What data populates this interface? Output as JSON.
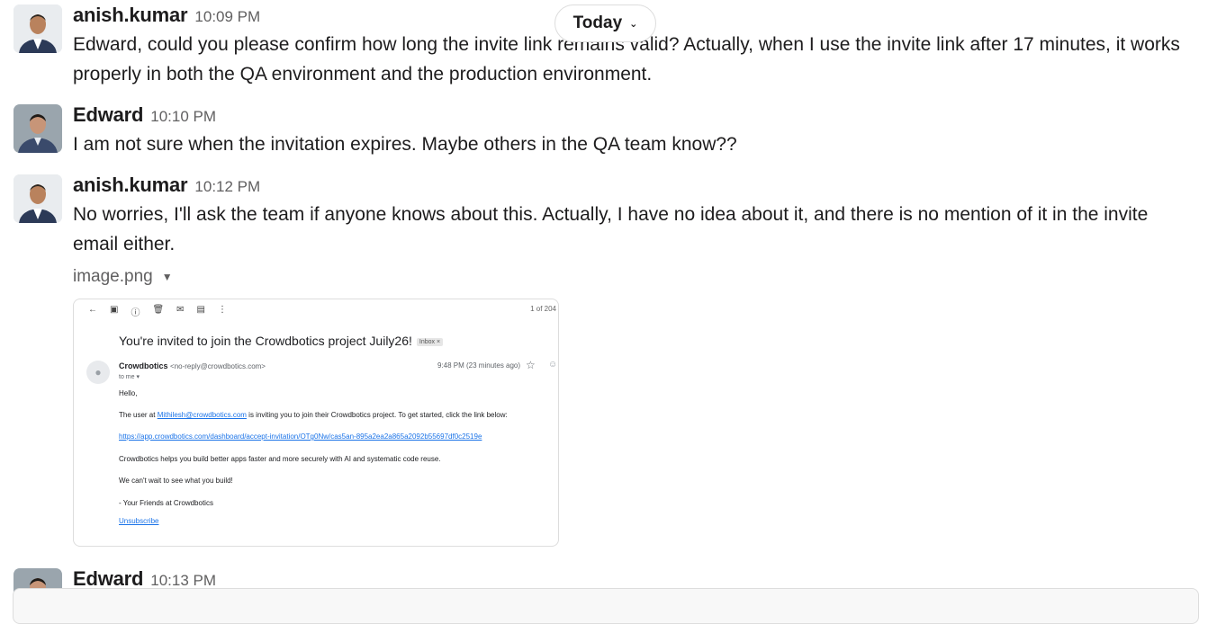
{
  "date_divider": {
    "label": "Today"
  },
  "messages": [
    {
      "author": "anish.kumar",
      "time": "10:09 PM",
      "text": "Edward, could you please confirm how long the invite link remains valid? Actually, when I use the invite link after 17 minutes, it works properly in both the QA environment and the production environment."
    },
    {
      "author": "Edward",
      "time": "10:10 PM",
      "text": "I am not sure when the invitation expires. Maybe others in the QA team know??"
    },
    {
      "author": "anish.kumar",
      "time": "10:12 PM",
      "text": "No worries, I'll ask the team if anyone knows about this. Actually, I have no idea about it, and there is no mention of it in the invite email either."
    },
    {
      "author": "Edward",
      "time": "10:13 PM",
      "text": ""
    }
  ],
  "attachment": {
    "file_name": "image.png",
    "email": {
      "counter": "1 of 204",
      "subject": "You're invited to join the Crowdbotics project Juily26!",
      "badge": "Inbox ×",
      "sender_name": "Crowdbotics",
      "sender_address": "<no-reply@crowdbotics.com>",
      "to": "to me ▾",
      "received": "9:48 PM (23 minutes ago)",
      "greeting": "Hello,",
      "line1_prefix": "The user at ",
      "line1_link": "Mithilesh@crowdbotics.com",
      "line1_suffix": " is inviting you to join their Crowdbotics project. To get started, click the link below:",
      "invite_link": "https://app.crowdbotics.com/dashboard/accept-invitation/OTg0Nw/cas5an-895a2ea2a865a2092b55697df0c2519e",
      "line2": "Crowdbotics helps you build better apps faster and more securely with AI and systematic code reuse.",
      "line3": "We can't wait to see what you build!",
      "signoff": "- Your Friends at Crowdbotics",
      "unsubscribe": "Unsubscribe"
    }
  },
  "colors": {
    "text": "#1d1c1d",
    "muted": "#616061",
    "link": "#1a73e8",
    "border": "#dddddd"
  }
}
